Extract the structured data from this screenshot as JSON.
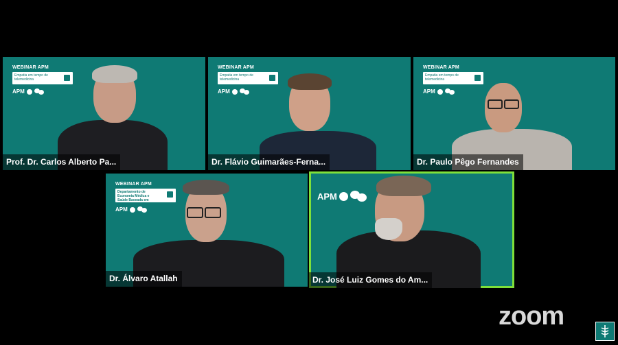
{
  "tiles": [
    {
      "name": "Prof. Dr. Carlos Alberto Pa...",
      "webinar": "WEBINAR APM",
      "card": "Empatia em tempo de telemedicina",
      "apm": "APM"
    },
    {
      "name": "Dr. Flávio Guimarães-Ferna...",
      "webinar": "WEBINAR APM",
      "card": "Empatia em tempo de telemedicina",
      "apm": "APM"
    },
    {
      "name": "Dr. Paulo Pêgo Fernandes",
      "webinar": "WEBINAR APM",
      "card": "Empatia em tempo de telemedicina",
      "apm": "APM"
    },
    {
      "name": "Dr. Álvaro Atallah",
      "webinar": "WEBINAR APM",
      "card": "Departamento de Economia Médica e Saúde Baseada em Evidências",
      "apm": "APM"
    },
    {
      "name": "Dr. José Luiz Gomes do Am...",
      "apm": "APM"
    }
  ],
  "app": {
    "brand": "zoom"
  },
  "colors": {
    "tile_bg": "#0f7a74",
    "active_border": "#7ee03a"
  }
}
